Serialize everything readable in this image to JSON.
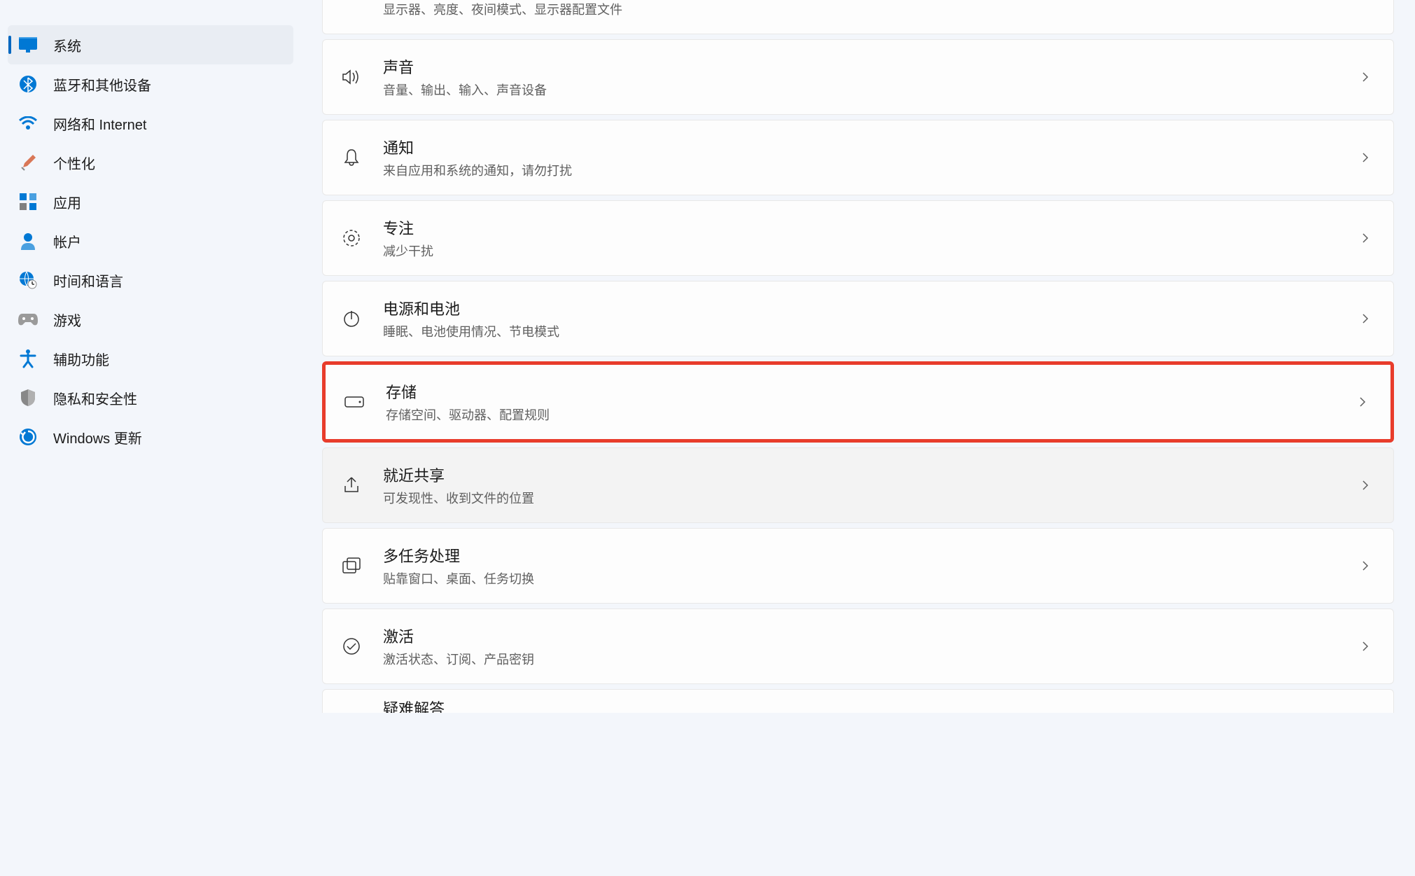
{
  "sidebar": {
    "items": [
      {
        "label": "系统",
        "active": true
      },
      {
        "label": "蓝牙和其他设备",
        "active": false
      },
      {
        "label": "网络和 Internet",
        "active": false
      },
      {
        "label": "个性化",
        "active": false
      },
      {
        "label": "应用",
        "active": false
      },
      {
        "label": "帐户",
        "active": false
      },
      {
        "label": "时间和语言",
        "active": false
      },
      {
        "label": "游戏",
        "active": false
      },
      {
        "label": "辅助功能",
        "active": false
      },
      {
        "label": "隐私和安全性",
        "active": false
      },
      {
        "label": "Windows 更新",
        "active": false
      }
    ]
  },
  "content": {
    "partial_top_desc": "显示器、亮度、夜间模式、显示器配置文件",
    "items": [
      {
        "title": "声音",
        "desc": "音量、输出、输入、声音设备"
      },
      {
        "title": "通知",
        "desc": "来自应用和系统的通知，请勿打扰"
      },
      {
        "title": "专注",
        "desc": "减少干扰"
      },
      {
        "title": "电源和电池",
        "desc": "睡眠、电池使用情况、节电模式"
      },
      {
        "title": "存储",
        "desc": "存储空间、驱动器、配置规则"
      },
      {
        "title": "就近共享",
        "desc": "可发现性、收到文件的位置"
      },
      {
        "title": "多任务处理",
        "desc": "贴靠窗口、桌面、任务切换"
      },
      {
        "title": "激活",
        "desc": "激活状态、订阅、产品密钥"
      }
    ],
    "partial_bottom_title": "疑难解答"
  }
}
